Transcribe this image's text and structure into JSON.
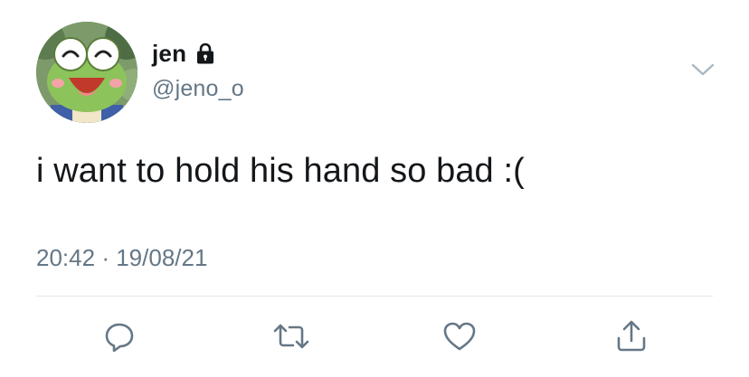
{
  "user": {
    "display_name": "jen",
    "handle": "@jeno_o",
    "protected_icon": "lock-icon",
    "avatar_icon": "keroppi-avatar"
  },
  "tweet": {
    "text": "i want to hold his hand so bad :(",
    "time": "20:42",
    "separator": "·",
    "date": "19/08/21"
  },
  "actions": {
    "reply_icon": "reply-icon",
    "retweet_icon": "retweet-icon",
    "like_icon": "heart-icon",
    "share_icon": "share-icon"
  },
  "colors": {
    "text_primary": "#14171a",
    "text_secondary": "#657786",
    "icon": "#657786",
    "divider": "#e1e8ed",
    "background": "#ffffff"
  }
}
